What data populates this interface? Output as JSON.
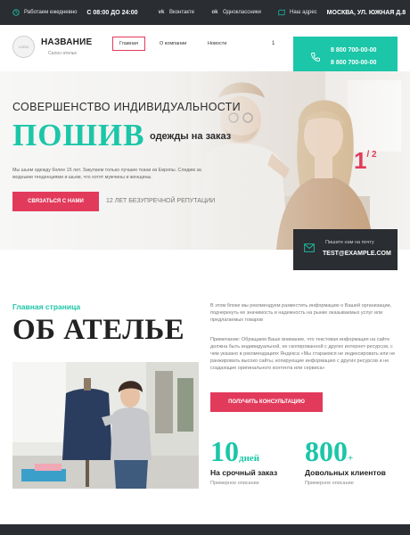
{
  "topbar": {
    "hours_label": "Работаем ежедневно",
    "hours_value": "С 08:00 ДО 24:00",
    "social_vk": "Вконтакте",
    "social_ok": "Одноклассники",
    "address_label": "Наш адрес",
    "address_value": "МОСКВА, УЛ. ЮЖНАЯ Д.8"
  },
  "header": {
    "logo_text": "LOGO",
    "brand_title": "НАЗВАНИЕ",
    "brand_subtitle": "Салон ателье",
    "nav": [
      {
        "label": "Главная",
        "active": true
      },
      {
        "label": "О компании",
        "active": false
      },
      {
        "label": "Новости",
        "active": false
      }
    ],
    "nav_extra": "1",
    "phones": [
      "8 800 700-00-00",
      "8 800 700-00-00"
    ]
  },
  "hero": {
    "tagline": "СОВЕРШЕНСТВО ИНДИВИДУАЛЬНОСТИ",
    "big_word": "ПОШИВ",
    "big_rest": "одежды на заказ",
    "description": "Мы шьем одежду более 15 лет. Закупаем только лучшие ткани из Европы. Следим за модными тенденциями и шьем, что хотят мужчины и женщины.",
    "button_label": "СВЯЗАТЬСЯ С НАМИ",
    "reputation": "12 ЛЕТ БЕЗУПРЕЧНОЙ РЕПУТАЦИИ",
    "slide_current": "1",
    "slide_total": "/ 2",
    "mail_label": "Пишите нам на почту",
    "mail_value": "TEST@EXAMPLE.COM"
  },
  "about": {
    "kicker": "Главная страница",
    "title": "ОБ АТЕЛЬЕ",
    "paragraph1": "В этом блоке мы рекомендуем разместить информацию о Вашей организации, подчеркнуть ее значимость и надежность на рынке оказываемых услуг или предлагаемых товаров",
    "paragraph2": "Примечание: Обращаем Ваше внимание, что текстовая информация на сайте должна быть индивидуальной, не скопированной с других интернет-ресурсов, с чем указано в рекомендациях Яндекса «Мы стараемся не индексировать или не ранжировать высоко сайты, копирующие информацию с других ресурсов и не создающие оригинального контента или сервиса»",
    "button_label": "ПОЛУЧИТЬ КОНСУЛЬТАЦИЮ",
    "stats": [
      {
        "number": "10",
        "unit": "дней",
        "label": "На срочный заказ",
        "sub": "Примерное описание"
      },
      {
        "number": "800",
        "unit": "+",
        "label": "Довольных клиентов",
        "sub": "Примерное описание"
      }
    ]
  },
  "colors": {
    "accent": "#1cc6a8",
    "brand_red": "#e23a5b",
    "dark": "#2a2d32"
  },
  "icons": {
    "clock": "clock-icon",
    "vk": "vk-icon",
    "ok": "ok-icon",
    "map": "map-icon",
    "phone": "phone-icon",
    "mail": "mail-icon"
  }
}
